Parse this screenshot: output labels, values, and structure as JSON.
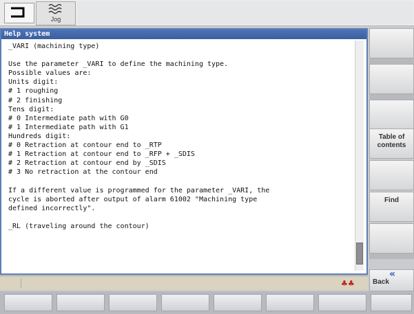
{
  "header": {
    "mode_label": "Jog"
  },
  "help": {
    "title": "Help system",
    "lines": [
      "_VARI (machining type)",
      "",
      "Use the parameter _VARI to define the machining type.",
      "Possible values are:",
      "Units digit:",
      "# 1 roughing",
      "# 2 finishing",
      "Tens digit:",
      "# 0 Intermediate path with G0",
      "# 1 Intermediate path with G1",
      "Hundreds digit:",
      "# 0 Retraction at contour end to _RTP",
      "# 1 Retraction at contour end to _RFP + _SDIS",
      "# 2 Retraction at contour end by _SDIS",
      "# 3 No retraction at the contour end",
      "",
      "If a different value is programmed for the parameter _VARI, the",
      "cycle is aborted after output of alarm 61002 \"Machining type",
      "defined incorrectly\".",
      "",
      "_RL (traveling around the contour)"
    ]
  },
  "softkeys": {
    "table_of_contents": "Table of\ncontents",
    "find": "Find",
    "back": "Back"
  },
  "icons": {
    "mode": "machine-mode-icon",
    "jog": "jog-icon",
    "status": "channel-status-icon",
    "back": "double-chevron-left-icon"
  },
  "colors": {
    "title_bar": "#4c73b8",
    "background": "#c9cbce"
  }
}
